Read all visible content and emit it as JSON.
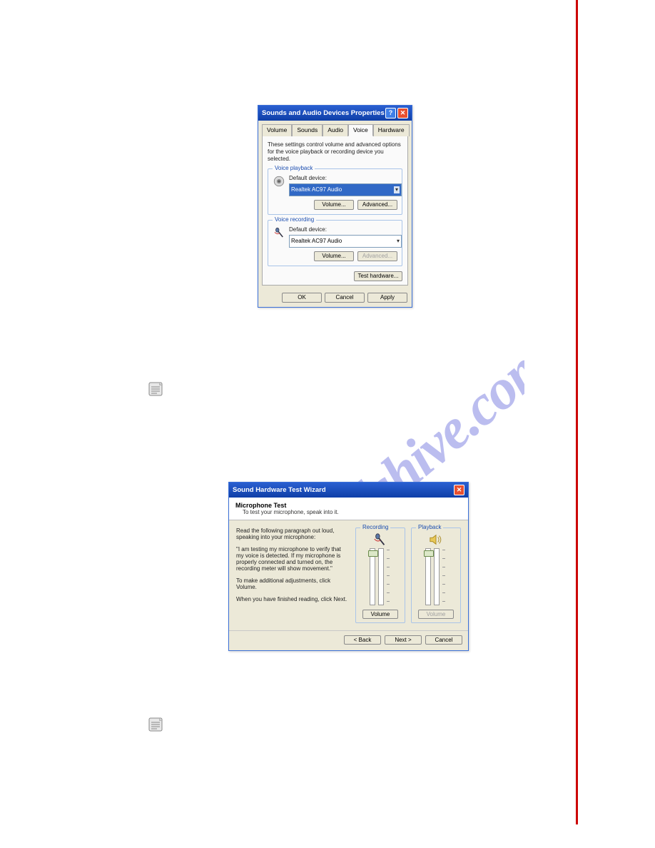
{
  "watermark": {
    "text": "manualshive.com"
  },
  "dialog1": {
    "title": "Sounds and Audio Devices Properties",
    "tabs": [
      "Volume",
      "Sounds",
      "Audio",
      "Voice",
      "Hardware"
    ],
    "activeTab": "Voice",
    "description": "These settings control volume and advanced options for the voice playback or recording device you selected.",
    "playback": {
      "groupLabel": "Voice playback",
      "defaultLabel": "Default device:",
      "device": "Realtek AC97 Audio",
      "buttons": {
        "volume": "Volume...",
        "advanced": "Advanced..."
      }
    },
    "recording": {
      "groupLabel": "Voice recording",
      "defaultLabel": "Default device:",
      "device": "Realtek AC97 Audio",
      "buttons": {
        "volume": "Volume...",
        "advanced": "Advanced..."
      }
    },
    "testHardware": "Test hardware...",
    "buttons": {
      "ok": "OK",
      "cancel": "Cancel",
      "apply": "Apply"
    }
  },
  "dialog2": {
    "title": "Sound Hardware Test Wizard",
    "header": {
      "title": "Microphone Test",
      "sub": "To test your microphone, speak into it."
    },
    "paragraphs": {
      "p1": "Read the following paragraph out loud, speaking into your microphone:",
      "p2": "\"I am testing my microphone to verify that my voice is detected. If my microphone is properly connected and turned on, the recording meter will show movement.\"",
      "p3": "To make additional adjustments, click Volume.",
      "p4": "When you have finished reading, click Next."
    },
    "recording": {
      "label": "Recording",
      "volume": "Volume"
    },
    "playback": {
      "label": "Playback",
      "volume": "Volume"
    },
    "buttons": {
      "back": "< Back",
      "next": "Next >",
      "cancel": "Cancel"
    }
  }
}
